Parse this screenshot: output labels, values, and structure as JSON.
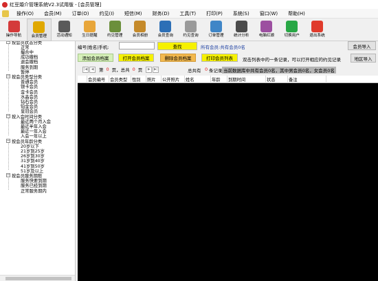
{
  "window": {
    "title": "红豆婚介管理系统V2.3试用版 - [会员管理]"
  },
  "menu": [
    "操作(O)",
    "会员(M)",
    "订单(O)",
    "约见(I)",
    "短信(M)",
    "财务(D)",
    "工具(T)",
    "打印(P)",
    "系统(S)",
    "窗口(W)",
    "帮助(H)"
  ],
  "toolbar": [
    {
      "label": "操作导航",
      "icon": "navigation-icon",
      "color": "#d43a3a"
    },
    {
      "label": "会员管理",
      "icon": "member-management-icon",
      "color": "#e0a800",
      "active": true
    },
    {
      "label": "活动通知",
      "icon": "megaphone-icon",
      "color": "#5a5a5a"
    },
    {
      "label": "生日提醒",
      "icon": "birthday-cake-icon",
      "color": "#e8a63a"
    },
    {
      "label": "约见管理",
      "icon": "appointment-icon",
      "color": "#6b8f3b"
    },
    {
      "label": "会员相册",
      "icon": "photo-album-icon",
      "color": "#c58a2a"
    },
    {
      "label": "会员查询",
      "icon": "magnifier-icon",
      "color": "#2d6fb6"
    },
    {
      "label": "约见查询",
      "icon": "pen-paper-icon",
      "color": "#9a9a9a"
    },
    {
      "label": "订单管理",
      "icon": "globe-order-icon",
      "color": "#3f86c7"
    },
    {
      "label": "统计分析",
      "icon": "statistics-icon",
      "color": "#4b4b4b"
    },
    {
      "label": "电脑红娘",
      "icon": "matchmaker-icon",
      "color": "#9c4fa0"
    },
    {
      "label": "切换用户",
      "icon": "switch-user-icon",
      "color": "#28a745"
    },
    {
      "label": "退出系统",
      "icon": "power-icon",
      "color": "#e03b2c"
    }
  ],
  "tree": [
    {
      "type": "group",
      "label": "按会员状态分类",
      "items": [
        "正常",
        "撮合中",
        "成功撤档",
        "退会撤档",
        "服务到期",
        "暂停"
      ]
    },
    {
      "type": "group",
      "label": "按会员类型分类",
      "items": [
        "普通会员",
        "银卡会员",
        "金卡会员",
        "水晶会员",
        "钻石会员",
        "铂金会员",
        "皇冠会员"
      ]
    },
    {
      "type": "group",
      "label": "按入会时间分类",
      "items": [
        "最近两个月入会",
        "最近半年入会",
        "最近一年入会",
        "入会一年以上"
      ]
    },
    {
      "type": "group",
      "label": "按会员年龄分类",
      "items": [
        "20岁以下",
        "21岁到25岁",
        "26岁到30岁",
        "31岁到40岁",
        "41岁到50岁",
        "51岁及以上"
      ]
    },
    {
      "type": "group",
      "label": "按会员服务期限",
      "items": [
        "服务快要到期",
        "服务已经到期",
        "正常服务期内"
      ]
    }
  ],
  "search": {
    "label": "编号|姓名|手机:",
    "value": "",
    "find_button": "查找",
    "result_text": "所有会员:共有会员0名",
    "import_button": "会员导入"
  },
  "actions": {
    "add": "添加会员档案",
    "open": "打开会员档案",
    "delete": "删除会员档案",
    "print": "打印会员列表",
    "hint": "双击列表中的一条记录，可以打开相应的约见记录",
    "region_import": "地区导入"
  },
  "pager": {
    "page_prefix": "第",
    "page_value": "0",
    "page_mid": "页，总共",
    "total_pages": "0",
    "page_suffix": "页",
    "record_prefix": "总共有",
    "record_count": "0",
    "record_suffix": "条记录",
    "summary_banner": "当前数据库中共有会员0名，其中男会员0名，女会员0名"
  },
  "grid": {
    "columns": [
      "会员编号",
      "会员类型",
      "性别",
      "照片",
      "公开照片",
      "姓名",
      "年龄",
      "到期时间",
      "状态",
      "备注"
    ]
  }
}
